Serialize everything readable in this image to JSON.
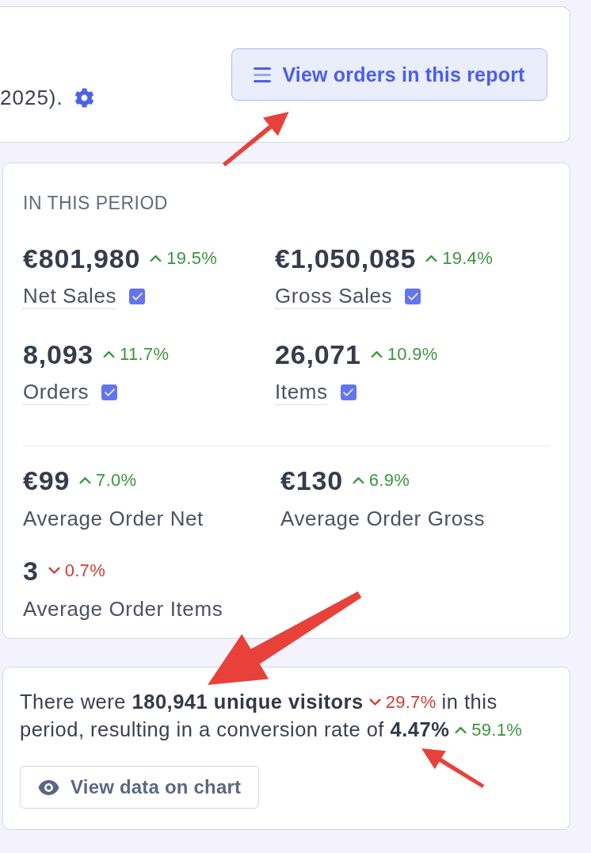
{
  "report_header": {
    "text": "2025).",
    "button": {
      "label": "View orders in this report"
    }
  },
  "period_summary": {
    "title": "IN THIS PERIOD",
    "metrics": [
      {
        "value": "€801,980",
        "change": "19.5%",
        "increase": true,
        "label": "Net Sales",
        "checked": true
      },
      {
        "value": "€1,050,085",
        "change": "19.4%",
        "increase": true,
        "label": "Gross Sales",
        "checked": true
      },
      {
        "value": "8,093",
        "change": "11.7%",
        "increase": true,
        "label": "Orders",
        "checked": true
      },
      {
        "value": "26,071",
        "change": "10.9%",
        "increase": true,
        "label": "Items",
        "checked": true
      }
    ],
    "averages": [
      {
        "value": "€99",
        "change": "7.0%",
        "increase": true,
        "label": "Average Order Net"
      },
      {
        "value": "€130",
        "change": "6.9%",
        "increase": true,
        "label": "Average Order Gross"
      },
      {
        "value": "3",
        "change": "0.7%",
        "increase": false,
        "label": "Average Order Items"
      }
    ]
  },
  "visitors": {
    "segments": [
      {
        "kind": "text",
        "text": "There were **180,941 unique visitors**"
      },
      {
        "kind": "change",
        "increase": false,
        "text": "29.7%"
      },
      {
        "kind": "text",
        "text": "in this"
      },
      {
        "kind": "text",
        "text": "period, resulting in a conversion rate of **4.47%**"
      },
      {
        "kind": "change",
        "increase": true,
        "text": "59.1%"
      }
    ],
    "button": {
      "label": "View data on chart"
    }
  }
}
